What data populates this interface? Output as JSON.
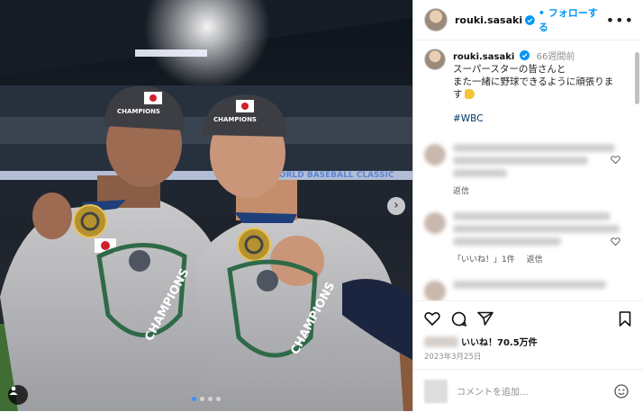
{
  "post": {
    "username": "rouki.sasaki",
    "follow_label": "フォローする",
    "time_ago": "66週間前",
    "caption": "スーパースターの皆さんと\nまた一緒に野球できるように頑張りま\nす",
    "caption_emoji": "flexed-biceps-emoji",
    "hashtag": "#WBC",
    "likes_label": "いいね！70.5万件",
    "date": "2023年3月25日",
    "comment_placeholder": "コメントを追加..."
  },
  "comments": [
    {
      "reply_label": "返信"
    },
    {
      "like_count_label": "「いいね！」1件",
      "reply_label": "返信"
    }
  ],
  "photo": {
    "cap_badge": "CHAMPIONS",
    "shirt_text": "CHAMPIONS",
    "banner_text": "WORLD BASEBALL CLASSIC",
    "carousel_dots": 4,
    "active_dot": 1
  },
  "icons": [
    "verified-badge-icon",
    "more-options-icon",
    "heart-icon",
    "comment-icon",
    "share-icon",
    "bookmark-icon",
    "emoji-icon",
    "user-tag-icon",
    "next-arrow-icon"
  ],
  "colors": {
    "link": "#0095f6",
    "hashtag": "#00376b",
    "verified": "#0095f6"
  }
}
